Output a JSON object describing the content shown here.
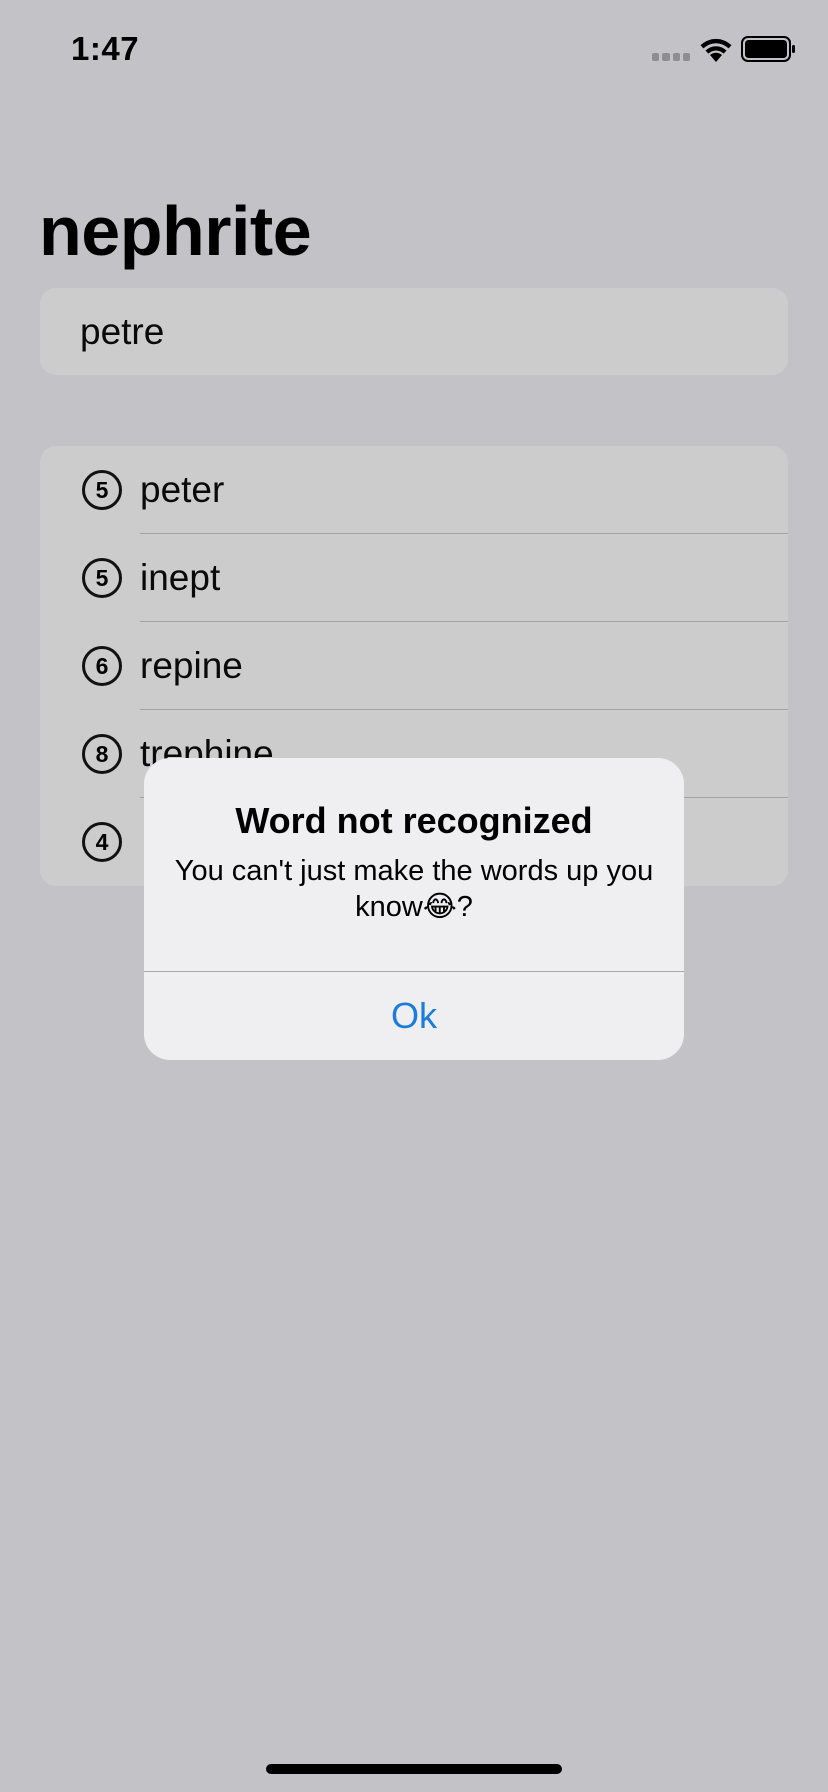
{
  "status_bar": {
    "time": "1:47"
  },
  "page": {
    "title": "nephrite"
  },
  "input": {
    "value": "petre"
  },
  "words": [
    {
      "count": "5",
      "word": "peter"
    },
    {
      "count": "5",
      "word": "inept"
    },
    {
      "count": "6",
      "word": "repine"
    },
    {
      "count": "8",
      "word": "trephine"
    },
    {
      "count": "4",
      "word": ""
    }
  ],
  "alert": {
    "title": "Word not recognized",
    "message": "You can't just make the words up you know😂?",
    "ok_label": "Ok"
  },
  "colors": {
    "background": "#c3c2c7",
    "accent": "#1a7cdd"
  }
}
